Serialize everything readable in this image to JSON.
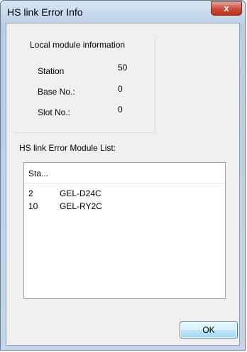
{
  "window": {
    "title": "HS link Error Info",
    "close_label": "x"
  },
  "local_info": {
    "group_label": "Local module information",
    "station_label": "Station",
    "station_value": "50",
    "base_label": "Base No.:",
    "base_value": "0",
    "slot_label": "Slot No.:",
    "slot_value": "0"
  },
  "error_list": {
    "label": "HS link Error Module List:",
    "column_header": "Sta...",
    "rows": [
      {
        "station": "2",
        "module": "GEL-D24C"
      },
      {
        "station": "10",
        "module": "GEL-RY2C"
      }
    ]
  },
  "buttons": {
    "ok_label": "OK"
  }
}
